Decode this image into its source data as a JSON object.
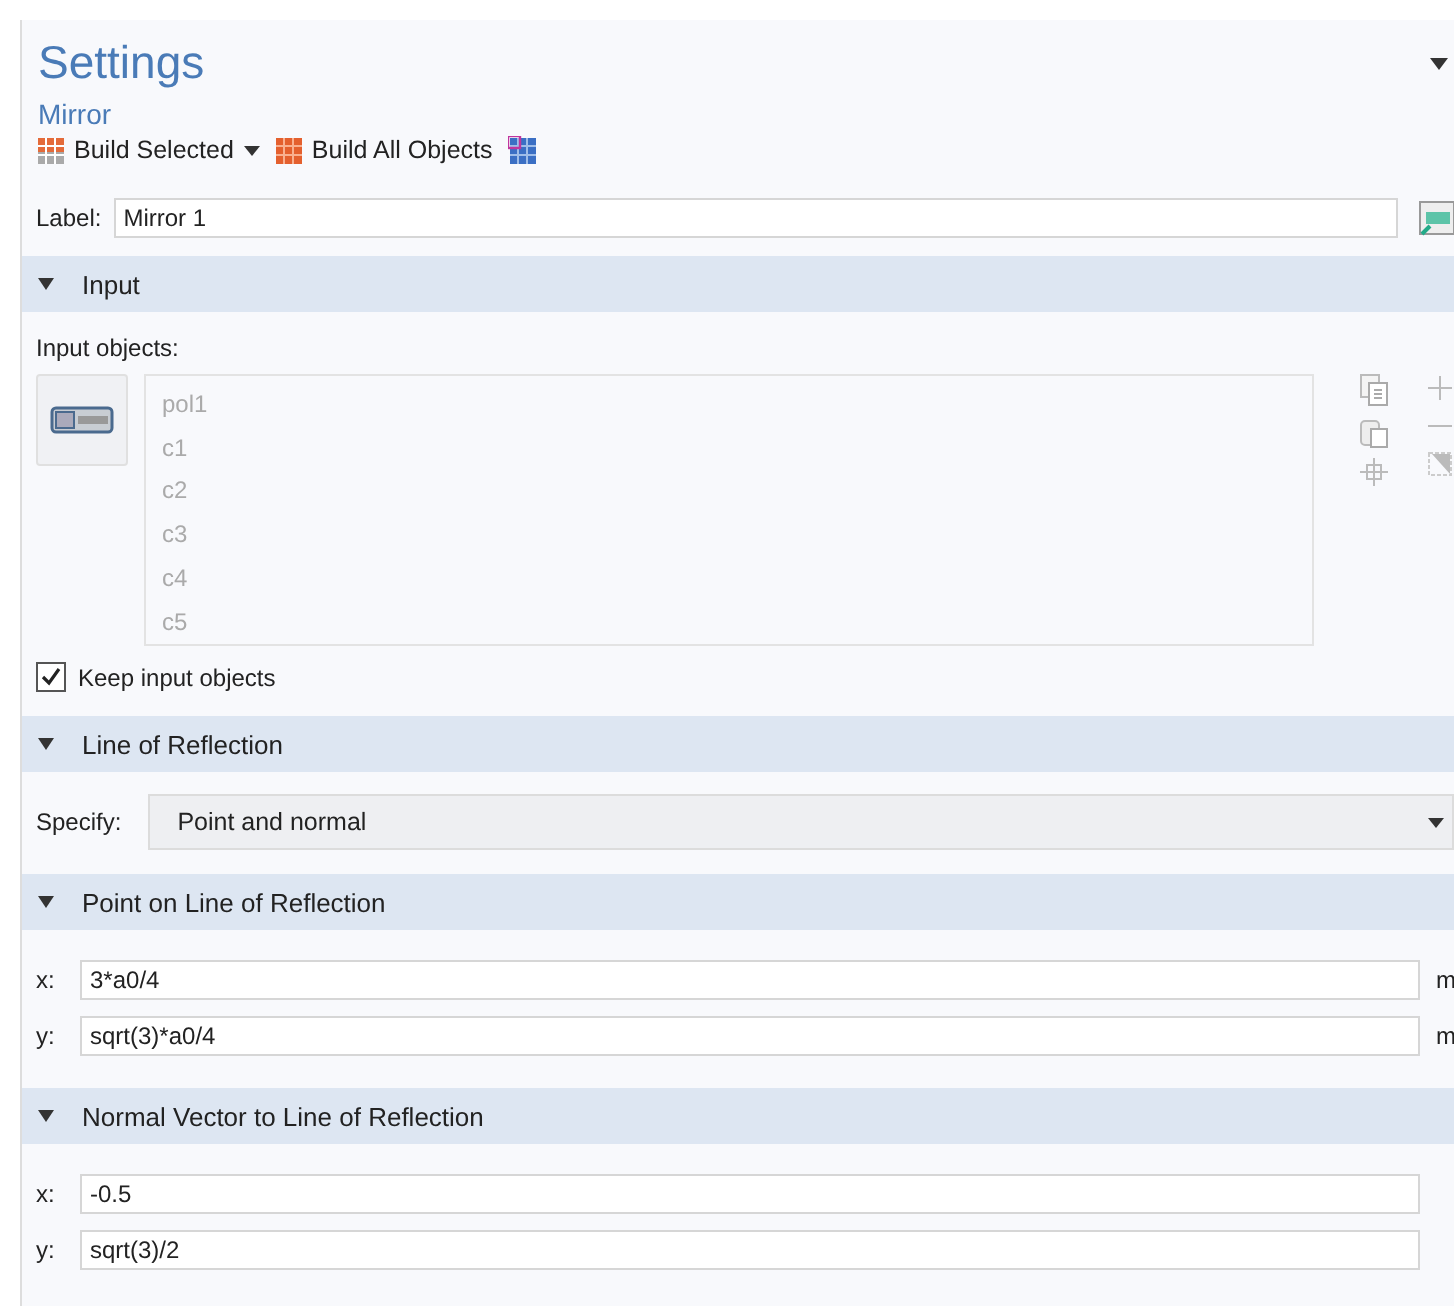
{
  "title": "Settings",
  "subtitle": "Mirror",
  "toolbar": [
    {
      "label": "Build Selected",
      "kind": "dropdown"
    },
    {
      "label": "Build All Objects",
      "kind": "button"
    },
    {
      "kind": "icon"
    }
  ],
  "label_field": {
    "label": "Label:",
    "value": "Mirror 1"
  },
  "sections": [
    {
      "title": "Input",
      "expanded": true,
      "items": [
        {
          "kind": "objects",
          "label": "Input objects:",
          "objects": [
            "pol1",
            "c1",
            "c2",
            "c3",
            "c4",
            "c5"
          ]
        },
        {
          "kind": "checkbox",
          "label": "Keep input objects",
          "checked": true
        }
      ]
    },
    {
      "title": "Line of Reflection",
      "expanded": true,
      "items": [
        {
          "kind": "select",
          "label": "Specify:",
          "value": "Point and normal"
        }
      ]
    },
    {
      "title": "Point on Line of Reflection",
      "expanded": true,
      "items": [
        {
          "kind": "field",
          "label": "x:",
          "value": "3*a0/4",
          "unit": "m"
        },
        {
          "kind": "field",
          "label": "y:",
          "value": "sqrt(3)*a0/4",
          "unit": "m"
        }
      ]
    },
    {
      "title": "Normal Vector to Line of Reflection",
      "expanded": true,
      "items": [
        {
          "kind": "field",
          "label": "x:",
          "value": "-0.5"
        },
        {
          "kind": "field",
          "label": "y:",
          "value": "sqrt(3)/2"
        }
      ]
    }
  ]
}
